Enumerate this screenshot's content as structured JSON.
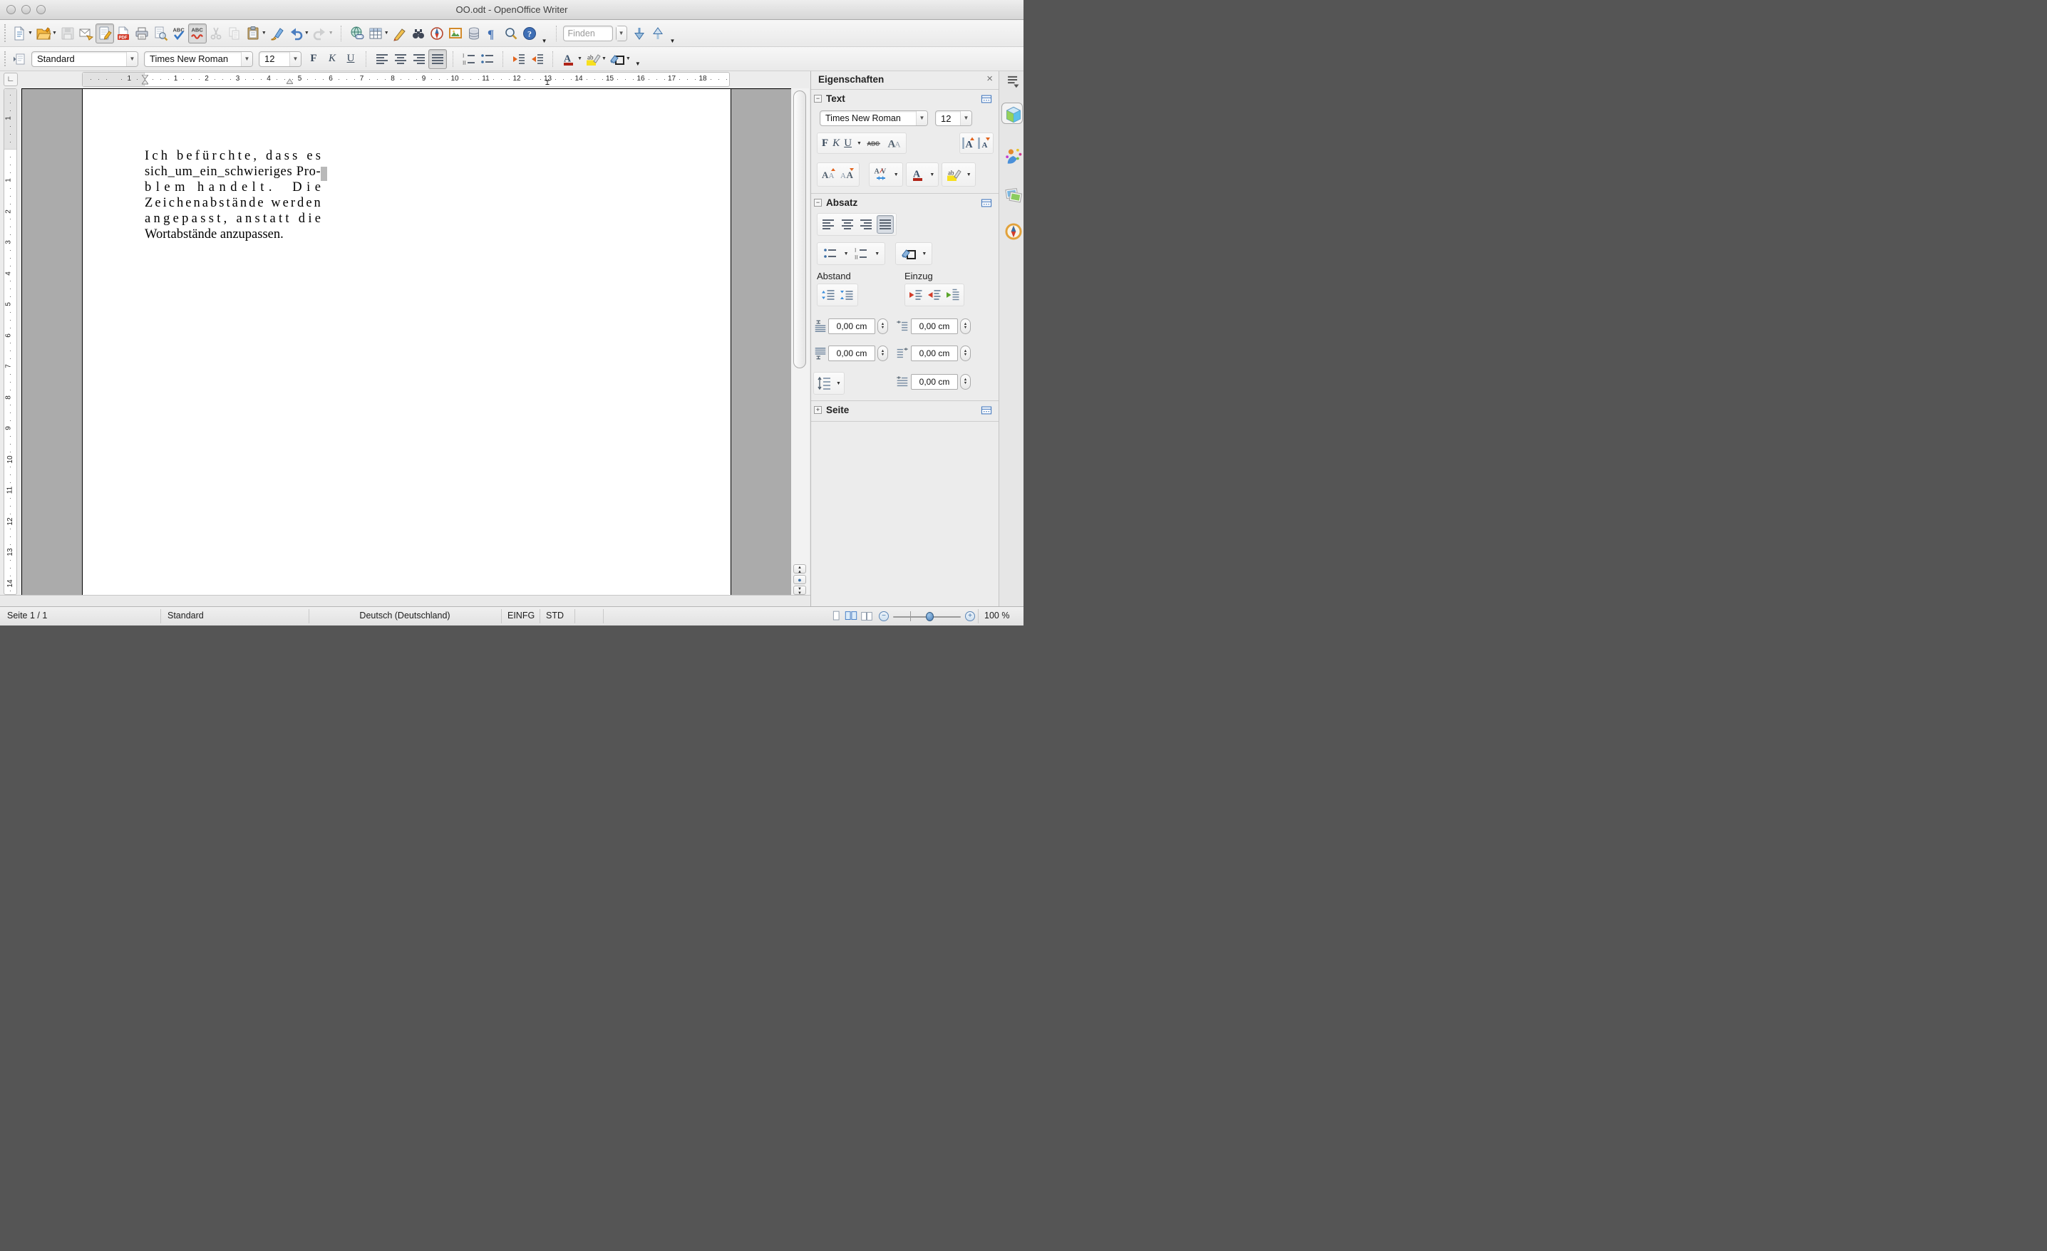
{
  "window": {
    "title": "OO.odt - OpenOffice Writer"
  },
  "main_toolbar": {
    "items": [
      {
        "name": "new-document-button",
        "icon": "doc-new",
        "dd": true
      },
      {
        "name": "open-button",
        "icon": "folder-open",
        "dd": true
      },
      {
        "name": "save-button",
        "icon": "floppy",
        "disabled": true
      },
      {
        "name": "email-document-button",
        "icon": "email"
      },
      {
        "name": "edit-file-button",
        "icon": "edit-file",
        "active": true
      },
      {
        "name": "export-pdf-button",
        "icon": "pdf"
      },
      {
        "name": "print-button",
        "icon": "printer"
      },
      {
        "name": "page-preview-button",
        "icon": "preview"
      },
      {
        "name": "spellcheck-button",
        "icon": "spell"
      },
      {
        "name": "autospellcheck-button",
        "icon": "autospell",
        "active": true
      },
      {
        "name": "cut-button",
        "icon": "cut",
        "disabled": true
      },
      {
        "name": "copy-button",
        "icon": "copy",
        "disabled": true
      },
      {
        "name": "paste-button",
        "icon": "paste",
        "dd": true
      },
      {
        "name": "format-paintbrush-button",
        "icon": "brush"
      },
      {
        "name": "undo-button",
        "icon": "undo",
        "dd": true
      },
      {
        "name": "redo-button",
        "icon": "redo",
        "disabled": true,
        "dd": true
      },
      {
        "sep": true
      },
      {
        "name": "hyperlink-button",
        "icon": "hyperlink"
      },
      {
        "name": "table-button",
        "icon": "table",
        "dd": true
      },
      {
        "name": "draw-functions-button",
        "icon": "draw"
      },
      {
        "name": "find-replace-button",
        "icon": "binoculars"
      },
      {
        "name": "navigator-button",
        "icon": "navigator"
      },
      {
        "name": "gallery-button",
        "icon": "gallery"
      },
      {
        "name": "data-sources-button",
        "icon": "database"
      },
      {
        "name": "formatting-marks-button",
        "icon": "pilcrow"
      },
      {
        "name": "zoom-button",
        "icon": "zoom"
      },
      {
        "name": "help-button",
        "icon": "help"
      },
      {
        "ovf": true
      },
      {
        "sep": true
      }
    ],
    "find": {
      "placeholder": "Finden"
    }
  },
  "format_toolbar": {
    "style_value": "Standard",
    "font_value": "Times New Roman",
    "size_value": "12",
    "items": [
      {
        "name": "bold-button",
        "ltr": "F",
        "style": "bold"
      },
      {
        "name": "italic-button",
        "ltr": "K",
        "style": "italic"
      },
      {
        "name": "underline-button",
        "ltr": "U",
        "style": "underline"
      },
      {
        "sep": true
      },
      {
        "name": "align-left-button",
        "icon": "align-l"
      },
      {
        "name": "align-center-button",
        "icon": "align-c"
      },
      {
        "name": "align-right-button",
        "icon": "align-r"
      },
      {
        "name": "align-justify-button",
        "icon": "align-j",
        "active": true
      },
      {
        "sep": true
      },
      {
        "name": "numbered-list-button",
        "icon": "list-num"
      },
      {
        "name": "bullet-list-button",
        "icon": "list-bullet"
      },
      {
        "sep": true
      },
      {
        "name": "decrease-indent-button",
        "icon": "ind-dec"
      },
      {
        "name": "increase-indent-button",
        "icon": "ind-inc"
      },
      {
        "sep": true
      },
      {
        "name": "font-color-button",
        "icon": "font-color",
        "dd": true
      },
      {
        "name": "highlighting-button",
        "icon": "highlight",
        "dd": true
      },
      {
        "name": "background-color-button",
        "icon": "bg-color",
        "dd": true
      },
      {
        "ovf": true
      }
    ]
  },
  "ruler": {
    "h_margin_label": "1",
    "h_numbers": [
      "1",
      "2",
      "3",
      "4",
      "5",
      "6",
      "7",
      "8",
      "9",
      "10",
      "11",
      "12",
      "13",
      "14",
      "15",
      "16",
      "17",
      "18"
    ],
    "v_margin_label": "1",
    "v_numbers": [
      "1",
      "2",
      "3",
      "4",
      "5",
      "6",
      "7",
      "8",
      "9",
      "10",
      "11",
      "12",
      "13",
      "14"
    ]
  },
  "document": {
    "lines": [
      {
        "text": "Ich befürchte, dass es",
        "justify": true
      },
      {
        "text": "sich_um_ein_schwieriges Pro-",
        "justify": true
      },
      {
        "text": "blem handelt.  Die",
        "justify": true
      },
      {
        "text": "Zeichenabstände werden",
        "justify": true
      },
      {
        "text": "angepasst, anstatt die",
        "justify": true
      },
      {
        "text": "Wortabstände anzupassen.",
        "justify": false
      }
    ]
  },
  "sidebar": {
    "title": "Eigenschaften",
    "close_label": "×",
    "text_section": {
      "title": "Text",
      "font_name": "Times New Roman",
      "font_size": "12"
    },
    "paragraph_section": {
      "title": "Absatz",
      "spacing_label": "Abstand",
      "indent_label": "Einzug",
      "spacing_above": "0,00 cm",
      "spacing_below": "0,00 cm",
      "indent_before": "0,00 cm",
      "indent_after": "0,00 cm",
      "indent_first_line": "0,00 cm"
    },
    "page_section": {
      "title": "Seite"
    }
  },
  "statusbar": {
    "page": "Seite 1 / 1",
    "style": "Standard",
    "language": "Deutsch (Deutschland)",
    "insert_mode": "EINFG",
    "selection_mode": "STD",
    "zoom": "100 %"
  }
}
